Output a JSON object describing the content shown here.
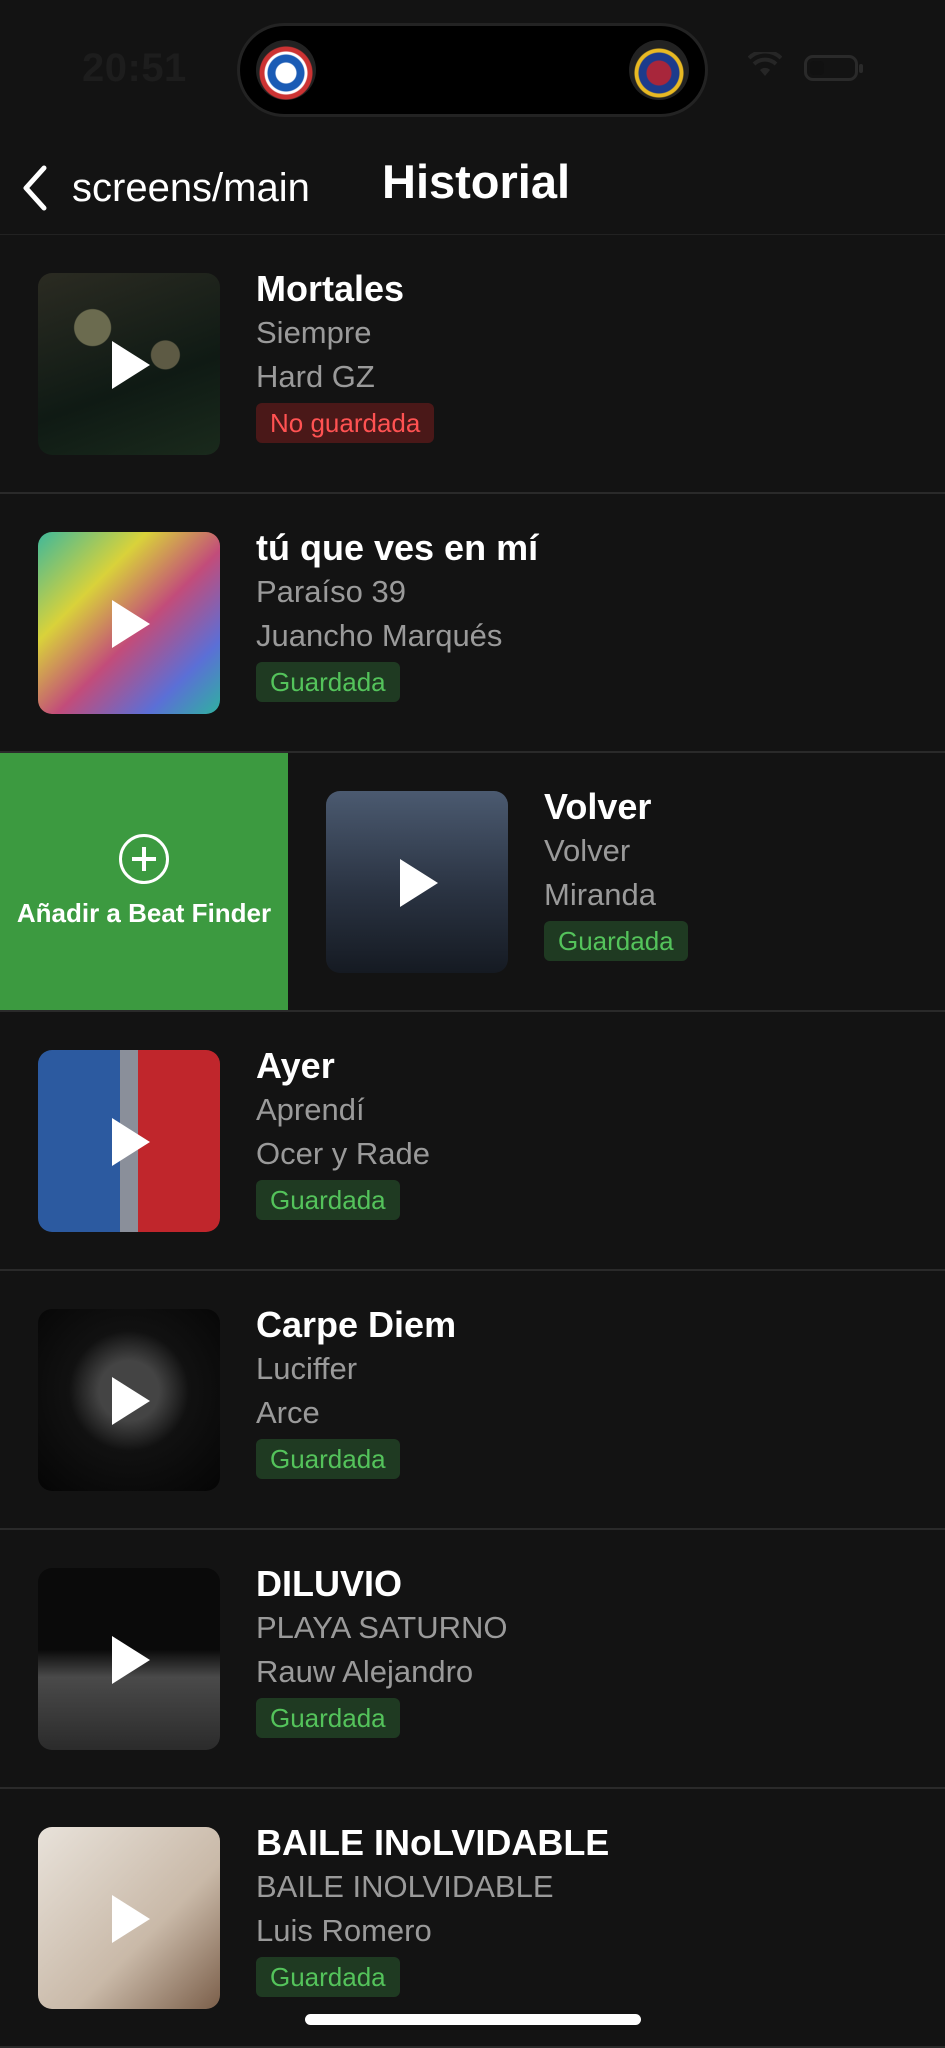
{
  "status_bar": {
    "time": "20:51"
  },
  "header": {
    "back_label": "screens/main",
    "title": "Historial"
  },
  "swipe_action": {
    "label": "Añadir a Beat Finder",
    "color": "#3c9a40"
  },
  "songs": [
    {
      "title": "Mortales",
      "album": "Siempre",
      "artist": "Hard GZ",
      "status": "No guardada",
      "saved": false
    },
    {
      "title": "tú que ves en mí",
      "album": "Paraíso 39",
      "artist": "Juancho Marqués",
      "status": "Guardada",
      "saved": true
    },
    {
      "title": "Volver",
      "album": "Volver",
      "artist": "Miranda",
      "status": "Guardada",
      "saved": true
    },
    {
      "title": "Ayer",
      "album": "Aprendí",
      "artist": "Ocer y Rade",
      "status": "Guardada",
      "saved": true
    },
    {
      "title": "Carpe Diem",
      "album": "Luciffer",
      "artist": "Arce",
      "status": "Guardada",
      "saved": true
    },
    {
      "title": "DILUVIO",
      "album": "PLAYA SATURNO",
      "artist": "Rauw Alejandro",
      "status": "Guardada",
      "saved": true
    },
    {
      "title": "BAILE INoLVIDABLE",
      "album": "BAILE INOLVIDABLE",
      "artist": "Luis Romero",
      "status": "Guardada",
      "saved": true
    }
  ],
  "colors": {
    "background": "#131313",
    "saved_tag": "#54c35b",
    "unsaved_tag": "#ff5252"
  }
}
